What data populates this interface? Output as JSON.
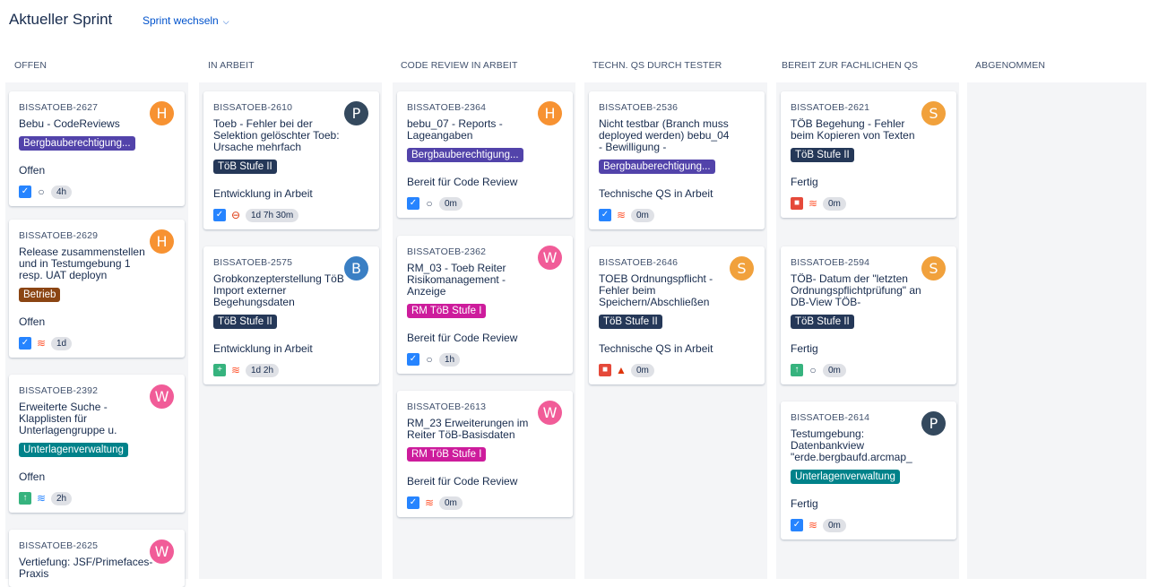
{
  "header": {
    "title": "Aktueller Sprint",
    "switch_label": "Sprint wechseln"
  },
  "columns": [
    {
      "name": "OFFEN"
    },
    {
      "name": "IN ARBEIT"
    },
    {
      "name": "CODE REVIEW IN ARBEIT"
    },
    {
      "name": "TECHN. QS DURCH TESTER"
    },
    {
      "name": "BEREIT ZUR FACHLICHEN QS"
    },
    {
      "name": "ABGENOMMEN"
    }
  ],
  "colors": {
    "epic_bergbau": "#5243aa",
    "epic_toeb": "#253858",
    "epic_betrieb": "#8b4513",
    "epic_unterlagen": "#00828a",
    "epic_rm": "#cd1c9c",
    "avatar_h": "#f79232",
    "avatar_p": "#34495e",
    "avatar_b": "#3a7fc4",
    "avatar_w": "#f15c98",
    "avatar_s": "#f1a13c"
  },
  "cards": [
    {
      "key": "BISSATOEB-2627",
      "summary": "Bebu - CodeReviews",
      "epic": "Bergbauberechtigung...",
      "status": "Offen",
      "avatar": "H",
      "type_icon": "checkbox-icon",
      "priority_icon": "priority-medium-icon",
      "estimate": "4h"
    },
    {
      "key": "BISSATOEB-2629",
      "summary": "Release zusammenstellen und in Testumgebung 1 resp. UAT deployn",
      "epic": "Betrieb",
      "status": "Offen",
      "avatar": "H",
      "type_icon": "checkbox-icon",
      "priority_icon": "priority-high-icon",
      "estimate": "1d"
    },
    {
      "key": "BISSATOEB-2392",
      "summary": "Erweiterte Suche - Klapplisten für Unterlagengruppe u.",
      "epic": "Unterlagenverwaltung",
      "status": "Offen",
      "avatar": "W",
      "type_icon": "improvement-icon",
      "priority_icon": "priority-lowest-icon",
      "estimate": "2h"
    },
    {
      "key": "BISSATOEB-2625",
      "summary": "Vertiefung: JSF/Primefaces-Praxis",
      "epic": "",
      "status": "",
      "avatar": "W",
      "type_icon": "",
      "priority_icon": "",
      "estimate": ""
    },
    {
      "key": "BISSATOEB-2610",
      "summary": "Toeb - Fehler bei der Selektion gelöschter Toeb: Ursache mehrfach",
      "epic": "TöB Stufe II",
      "status": "Entwicklung in Arbeit",
      "avatar": "P",
      "type_icon": "checkbox-icon",
      "priority_icon": "priority-blocker-icon",
      "estimate": "1d 7h 30m"
    },
    {
      "key": "BISSATOEB-2575",
      "summary": "Grobkonzepterstellung TöB Import externer Begehungsdaten",
      "epic": "TöB Stufe II",
      "status": "Entwicklung in Arbeit",
      "avatar": "B",
      "type_icon": "new-feature-icon",
      "priority_icon": "priority-high-icon",
      "estimate": "1d 2h"
    },
    {
      "key": "BISSATOEB-2364",
      "summary": "bebu_07 - Reports - Lageangaben",
      "epic": "Bergbauberechtigung...",
      "status": "Bereit für Code Review",
      "avatar": "H",
      "type_icon": "checkbox-icon",
      "priority_icon": "priority-medium-icon",
      "estimate": "0m"
    },
    {
      "key": "BISSATOEB-2362",
      "summary": "RM_03 - Toeb Reiter Risikomanagement - Anzeige",
      "epic": "RM TöB Stufe I",
      "status": "Bereit für Code Review",
      "avatar": "W",
      "type_icon": "checkbox-icon",
      "priority_icon": "priority-medium-icon",
      "estimate": "1h"
    },
    {
      "key": "BISSATOEB-2613",
      "summary": "RM_23 Erweiterungen im Reiter TöB-Basisdaten",
      "epic": "RM TöB Stufe I",
      "status": "Bereit für Code Review",
      "avatar": "W",
      "type_icon": "checkbox-icon",
      "priority_icon": "priority-high-icon",
      "estimate": "0m"
    },
    {
      "key": "BISSATOEB-2536",
      "summary": "Nicht testbar (Branch muss deployed werden) bebu_04 - Bewilligung -",
      "epic": "Bergbauberechtigung...",
      "status": "Technische QS in Arbeit",
      "avatar": "",
      "type_icon": "checkbox-icon",
      "priority_icon": "priority-high-icon",
      "estimate": "0m"
    },
    {
      "key": "BISSATOEB-2646",
      "summary": "TOEB Ordnungspflicht - Fehler beim Speichern/Abschließen",
      "epic": "TöB Stufe II",
      "status": "Technische QS in Arbeit",
      "avatar": "S",
      "type_icon": "bug-icon",
      "priority_icon": "priority-critical-icon",
      "estimate": "0m"
    },
    {
      "key": "BISSATOEB-2621",
      "summary": "TÖB Begehung - Fehler beim Kopieren von Texten",
      "epic": "TöB Stufe II",
      "status": "Fertig",
      "avatar": "S",
      "type_icon": "bug-icon",
      "priority_icon": "priority-high-icon",
      "estimate": "0m"
    },
    {
      "key": "BISSATOEB-2594",
      "summary": "TÖB- Datum der \"letzten Ordnungspflichtprüfung\" an DB-View TÖB-",
      "epic": "TöB Stufe II",
      "status": "Fertig",
      "avatar": "S",
      "type_icon": "improvement-icon",
      "priority_icon": "priority-medium-icon",
      "estimate": "0m"
    },
    {
      "key": "BISSATOEB-2614",
      "summary": "Testumgebung: Datenbankview \"erde.bergbaufd.arcmap_",
      "epic": "Unterlagenverwaltung",
      "status": "Fertig",
      "avatar": "P",
      "type_icon": "checkbox-icon",
      "priority_icon": "priority-high-icon",
      "estimate": "0m"
    }
  ]
}
